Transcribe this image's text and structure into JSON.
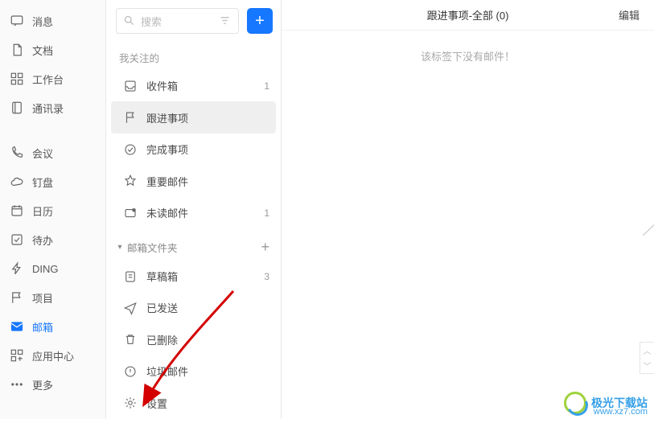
{
  "leftnav": {
    "group1": [
      {
        "icon": "chat",
        "label": "消息"
      },
      {
        "icon": "doc",
        "label": "文档"
      },
      {
        "icon": "grid",
        "label": "工作台"
      },
      {
        "icon": "book",
        "label": "通讯录"
      }
    ],
    "group2": [
      {
        "icon": "phone",
        "label": "会议"
      },
      {
        "icon": "cloud",
        "label": "钉盘"
      },
      {
        "icon": "calendar",
        "label": "日历"
      },
      {
        "icon": "check",
        "label": "待办"
      },
      {
        "icon": "bolt",
        "label": "DING"
      },
      {
        "icon": "flag",
        "label": "项目"
      },
      {
        "icon": "mail",
        "label": "邮箱",
        "active": true
      },
      {
        "icon": "apps",
        "label": "应用中心"
      },
      {
        "icon": "more",
        "label": "更多"
      }
    ]
  },
  "search": {
    "placeholder": "搜索"
  },
  "sections": {
    "followed_title": "我关注的",
    "folders_title": "邮箱文件夹"
  },
  "followed": [
    {
      "icon": "inbox",
      "label": "收件箱",
      "count": "1"
    },
    {
      "icon": "flag",
      "label": "跟进事项",
      "selected": true
    },
    {
      "icon": "done",
      "label": "完成事项"
    },
    {
      "icon": "star",
      "label": "重要邮件"
    },
    {
      "icon": "unread",
      "label": "未读邮件",
      "count": "1"
    }
  ],
  "folders": [
    {
      "icon": "draft",
      "label": "草稿箱",
      "count": "3"
    },
    {
      "icon": "sent",
      "label": "已发送"
    },
    {
      "icon": "trash",
      "label": "已删除"
    },
    {
      "icon": "spam",
      "label": "垃圾邮件"
    },
    {
      "icon": "gear",
      "label": "设置"
    }
  ],
  "right": {
    "title": "跟进事项-全部 (0)",
    "edit": "编辑",
    "empty": "该标签下没有邮件！"
  },
  "watermark": {
    "cn": "极光下载站",
    "url": "www.xz7.com"
  }
}
